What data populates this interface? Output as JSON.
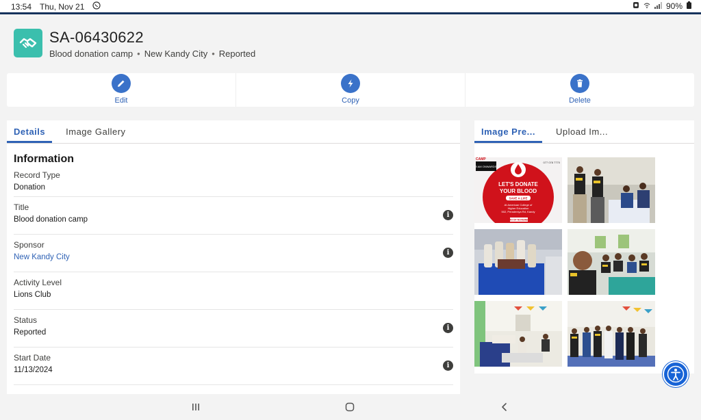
{
  "status_bar": {
    "time": "13:54",
    "date": "Thu, Nov 21",
    "battery": "90%",
    "icons": [
      "whatsapp-icon",
      "alarm-icon",
      "wifi-icon",
      "signal-icon",
      "battery-icon"
    ]
  },
  "record": {
    "title": "SA-06430622",
    "subtitle_parts": [
      "Blood donation camp",
      "New Kandy City",
      "Reported"
    ],
    "icon": "handshake-icon",
    "icon_color": "#3bbfad"
  },
  "actions": [
    {
      "label": "Edit",
      "icon": "pencil-icon"
    },
    {
      "label": "Copy",
      "icon": "lightning-icon"
    },
    {
      "label": "Delete",
      "icon": "trash-icon"
    }
  ],
  "left_tabs": [
    "Details",
    "Image Gallery"
  ],
  "section_title": "Information",
  "fields": [
    {
      "label": "Record Type",
      "value": "Donation"
    },
    {
      "label": "Title",
      "value": "Blood donation camp"
    },
    {
      "label": "Sponsor",
      "value": "New Kandy City"
    },
    {
      "label": "Activity Level",
      "value": "Lions Club"
    },
    {
      "label": "Status",
      "value": "Reported"
    },
    {
      "label": "Start Date",
      "value": "11/13/2024"
    }
  ],
  "right_tabs": [
    "Image Pre...",
    "Upload Im..."
  ],
  "poster": {
    "camp": "CAMP",
    "phone": "077 078 7770",
    "time_badge": "9 AM ONWARDS",
    "heading_line1": "LET'S DONATE",
    "heading_line2": "YOUR BLOOD",
    "save": "SAVE A LIFE",
    "venue_line1": "At American College of",
    "venue_line2": "Higher Education",
    "venue_line3": "502, Peradeniya Rd, Kandy",
    "date": "13TH OF NOVEMBER"
  },
  "colors": {
    "accent": "#2f62b5",
    "action_circle": "#3a72c9",
    "header_line": "#16325c",
    "a11y_button": "#1763d6"
  }
}
